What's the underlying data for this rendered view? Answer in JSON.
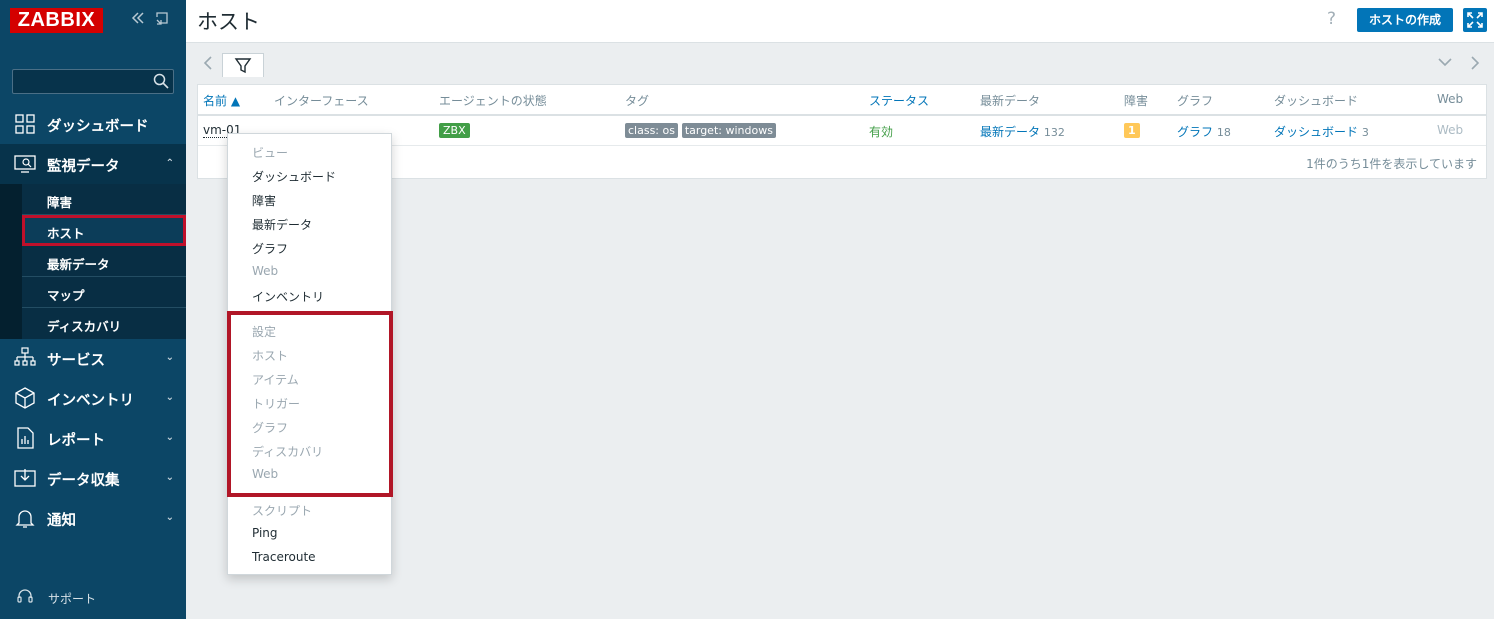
{
  "logo": "ZABBIX",
  "sidebar": {
    "menu": [
      {
        "label": "ダッシュボード",
        "icon": "dashboard-icon"
      },
      {
        "label": "監視データ",
        "icon": "monitoring-icon"
      },
      {
        "label": "サービス",
        "icon": "services-icon"
      },
      {
        "label": "インベントリ",
        "icon": "inventory-icon"
      },
      {
        "label": "レポート",
        "icon": "reports-icon"
      },
      {
        "label": "データ収集",
        "icon": "data-collection-icon"
      },
      {
        "label": "通知",
        "icon": "alerts-icon"
      }
    ],
    "submenu": [
      "障害",
      "ホスト",
      "最新データ",
      "マップ",
      "ディスカバリ"
    ],
    "support": "サポート"
  },
  "header": {
    "title": "ホスト",
    "help": "?",
    "create_button": "ホストの作成"
  },
  "table": {
    "columns": [
      "名前 ▲",
      "インターフェース",
      "エージェントの状態",
      "タグ",
      "ステータス",
      "最新データ",
      "障害",
      "グラフ",
      "ダッシュボード",
      "Web"
    ],
    "row": {
      "name": "vm-01",
      "agent": "ZBX",
      "tags": [
        "class: os",
        "target: windows"
      ],
      "status": "有効",
      "latest_label": "最新データ",
      "latest_count": "132",
      "problems": "1",
      "graphs_label": "グラフ",
      "graphs_count": "18",
      "dash_label": "ダッシュボード",
      "dash_count": "3",
      "web": "Web"
    },
    "footer": "1件のうち1件を表示しています"
  },
  "context_menu": {
    "view_header": "ビュー",
    "view_items": [
      "ダッシュボード",
      "障害",
      "最新データ",
      "グラフ",
      "Web",
      "インベントリ"
    ],
    "config_header": "設定",
    "config_items": [
      "ホスト",
      "アイテム",
      "トリガー",
      "グラフ",
      "ディスカバリ",
      "Web"
    ],
    "scripts_header": "スクリプト",
    "script_items": [
      "Ping",
      "Traceroute"
    ]
  }
}
